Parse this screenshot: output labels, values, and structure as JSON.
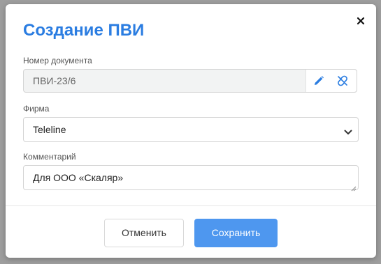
{
  "dialog": {
    "title": "Создание ПВИ",
    "close_icon": "close-icon"
  },
  "fields": {
    "doc_number": {
      "label": "Номер документа",
      "value": "ПВИ-23/6",
      "edit_icon": "pencil-icon",
      "unlink_icon": "unlink-icon"
    },
    "firm": {
      "label": "Фирма",
      "value": "Teleline",
      "chevron_icon": "chevron-down-icon"
    },
    "comment": {
      "label": "Комментарий",
      "value": "Для ООО «Скаляр»"
    }
  },
  "footer": {
    "cancel_label": "Отменить",
    "save_label": "Сохранить"
  },
  "colors": {
    "accent": "#2b7de1",
    "primary_button": "#4e97ef",
    "overlay": "#9e9e9e"
  }
}
